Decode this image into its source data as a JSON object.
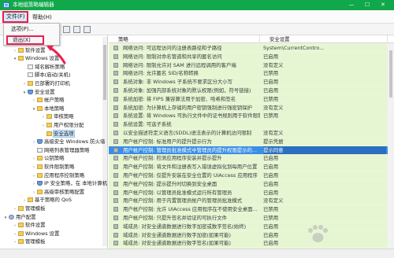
{
  "window": {
    "title": "本地组策略编辑器",
    "icon": "group-policy-app-icon",
    "controls": [
      "—",
      "☐",
      "✕"
    ],
    "title_color": "#10a84a"
  },
  "menubar": {
    "file_label": "文件(F)",
    "help_label": "帮助(H)"
  },
  "file_menu": {
    "options_label": "选项(P)...",
    "exit_label": "退出(X)"
  },
  "tree": {
    "items": [
      {
        "label": "",
        "icon": "computer-icon",
        "expander": "▾",
        "indent": 4
      },
      {
        "label": "软件设置",
        "icon": "folder-icon",
        "expander": "›",
        "indent": 16
      },
      {
        "label": "Windows 设置",
        "icon": "folder-icon",
        "expander": "▾",
        "indent": 16
      },
      {
        "label": "域名解析策略",
        "icon": "doc-icon",
        "expander": "",
        "indent": 28
      },
      {
        "label": "脚本(启动/关机)",
        "icon": "doc-icon",
        "expander": "",
        "indent": 28
      },
      {
        "label": "已部署的打印机",
        "icon": "folder-icon",
        "expander": "›",
        "indent": 28
      },
      {
        "label": "安全设置",
        "icon": "shield-icon",
        "expander": "▾",
        "indent": 28
      },
      {
        "label": "帐户策略",
        "icon": "folder-icon",
        "expander": "›",
        "indent": 40
      },
      {
        "label": "本地策略",
        "icon": "folder-icon",
        "expander": "▾",
        "indent": 40
      },
      {
        "label": "审核策略",
        "icon": "folder-icon",
        "expander": "›",
        "indent": 52
      },
      {
        "label": "用户权限分配",
        "icon": "folder-icon",
        "expander": "›",
        "indent": 52
      },
      {
        "label": "安全选项",
        "icon": "folder-icon",
        "expander": "",
        "indent": 52,
        "selected": true
      },
      {
        "label": "高级安全 Windows 防火墙",
        "icon": "shield-icon",
        "expander": "›",
        "indent": 40
      },
      {
        "label": "网络列表管理器策略",
        "icon": "doc-icon",
        "expander": "",
        "indent": 40
      },
      {
        "label": "公钥策略",
        "icon": "folder-icon",
        "expander": "›",
        "indent": 40
      },
      {
        "label": "软件限制策略",
        "icon": "folder-icon",
        "expander": "›",
        "indent": 40
      },
      {
        "label": "应用程序控制策略",
        "icon": "folder-icon",
        "expander": "›",
        "indent": 40
      },
      {
        "label": "IP 安全策略，在 本地计算机",
        "icon": "shield-icon",
        "expander": "›",
        "indent": 40
      },
      {
        "label": "高级审核策略配置",
        "icon": "folder-icon",
        "expander": "›",
        "indent": 40
      },
      {
        "label": "基于策略的 QoS",
        "icon": "folder-icon",
        "expander": "›",
        "indent": 28
      },
      {
        "label": "管理模板",
        "icon": "folder-icon",
        "expander": "›",
        "indent": 16
      },
      {
        "label": "用户配置",
        "icon": "person-icon",
        "expander": "▾",
        "indent": 4
      },
      {
        "label": "软件设置",
        "icon": "folder-icon",
        "expander": "›",
        "indent": 16
      },
      {
        "label": "Windows 设置",
        "icon": "folder-icon",
        "expander": "›",
        "indent": 16
      },
      {
        "label": "管理模板",
        "icon": "folder-icon",
        "expander": "›",
        "indent": 16
      }
    ]
  },
  "policies": {
    "columns": {
      "name": "策略",
      "setting": "安全设置"
    },
    "rows": [
      {
        "name": "网络访问: 可远程访问的注册表路径和子路径",
        "setting": "System\\CurrentContro..."
      },
      {
        "name": "网络访问: 限制对命名管道和共享的匿名访问",
        "setting": "已启用"
      },
      {
        "name": "网络访问: 限制允许对 SAM 进行远程调用的客户端",
        "setting": "没有定义"
      },
      {
        "name": "网络访问: 允许匿名 SID/名称转换",
        "setting": "已禁用"
      },
      {
        "name": "系统对象: 非 Windows 子系统不要求区分大小写",
        "setting": "已启用"
      },
      {
        "name": "系统对象: 加强内部系统对象的默认权限(例如，符号链接)",
        "setting": "已启用"
      },
      {
        "name": "系统加密: 将 FIPS 兼容算法用于加密、哈希和签名",
        "setting": "已禁用"
      },
      {
        "name": "系统加密: 为计算机上存储的用户密钥强制进行强密钥保护",
        "setting": "没有定义"
      },
      {
        "name": "系统设置: 将 Windows 可执行文件中的证书规则用于软件限制...",
        "setting": "已禁用"
      },
      {
        "name": "系统设置: 可选子系统",
        "setting": ""
      },
      {
        "name": "以安全描述符定义语言(SDDL)语法表示的计算机访问限制",
        "setting": "没有定义"
      },
      {
        "name": "用户帐户控制: 标准用户的提升提示行为",
        "setting": "提示凭据"
      },
      {
        "name": "用户帐户控制: 管理员批准模式中管理员的提升权限提示的...",
        "setting": "提示同意",
        "selected": true
      },
      {
        "name": "用户帐户控制: 检测应用程序安装并提示提升",
        "setting": "已启用"
      },
      {
        "name": "用户帐户控制: 将文件和注册表写入错误虚拟化到每用户位置",
        "setting": "已启用"
      },
      {
        "name": "用户帐户控制: 仅提升安装在安全位置的 UIAccess 应用程序",
        "setting": "已启用"
      },
      {
        "name": "用户帐户控制: 提示提升时切换到安全桌面",
        "setting": "已启用"
      },
      {
        "name": "用户帐户控制: 以管理员批准模式运行所有管理员",
        "setting": "已启用"
      },
      {
        "name": "用户帐户控制: 用于内置管理员帐户的管理员批准模式",
        "setting": "没有定义"
      },
      {
        "name": "用户帐户控制: 允许 UIAccess 应用程序在不使用安全桌面...",
        "setting": "已禁用"
      },
      {
        "name": "用户帐户控制: 只提升签名并验证的可执行文件",
        "setting": "已禁用"
      },
      {
        "name": "域成员: 对安全通道数据进行数字加密或数字签名(始终)",
        "setting": "已启用"
      },
      {
        "name": "域成员: 对安全通道数据进行数字加密(如果可能)",
        "setting": "已启用"
      },
      {
        "name": "域成员: 对安全通道数据进行数字签名(如果可能)",
        "setting": "已启用"
      }
    ]
  },
  "watermark": {
    "label": "Baidu 经验"
  },
  "colors": {
    "annotation": "#e8204f",
    "selection": "#3a8ee6",
    "list_background": "#e6f6d3"
  }
}
